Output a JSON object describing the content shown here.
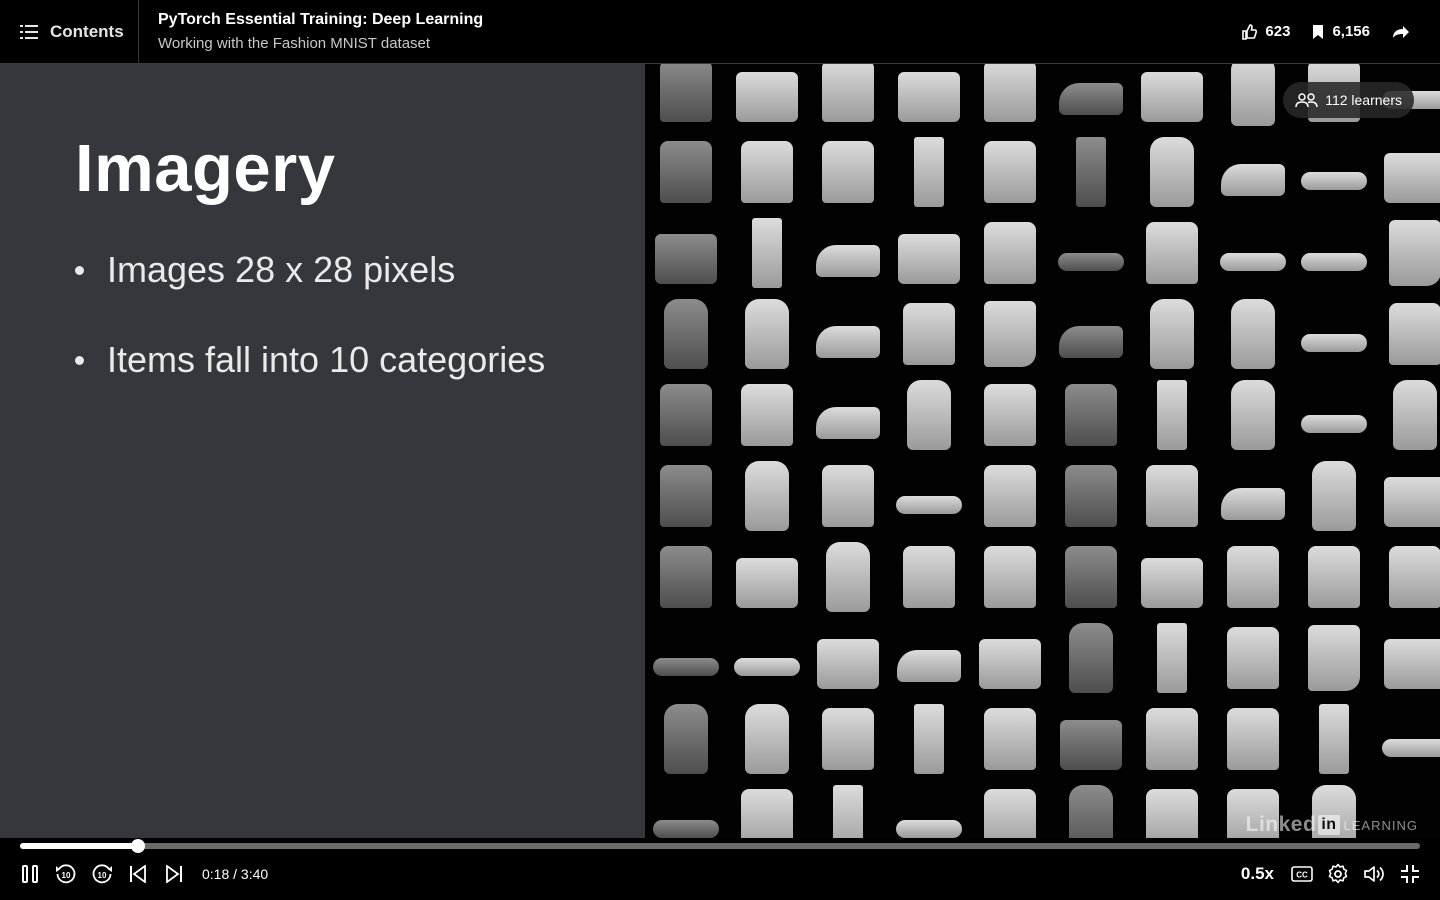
{
  "header": {
    "contents_label": "Contents",
    "course_title": "PyTorch Essential Training: Deep Learning",
    "video_title": "Working with the Fashion MNIST dataset",
    "likes": "623",
    "saves": "6,156"
  },
  "slide": {
    "heading": "Imagery",
    "bullets": [
      "Images 28 x 28 pixels",
      "Items fall into 10 categories"
    ],
    "image_description_icon": "fashion-mnist-grid",
    "watermark": {
      "brand_prefix": "Linked",
      "brand_in": "in",
      "brand_suffix": "LEARNING"
    }
  },
  "learners": {
    "label": "112 learners"
  },
  "player": {
    "current_time": "0:18",
    "duration": "3:40",
    "time_display": "0:18 / 3:40",
    "progress_fraction": 0.0845,
    "speed": "0.5x",
    "skip_seconds_back": "10",
    "skip_seconds_forward": "10"
  },
  "colors": {
    "slide_bg": "#34373b",
    "accent": "#ffffff",
    "track": "#6b6b6b"
  }
}
